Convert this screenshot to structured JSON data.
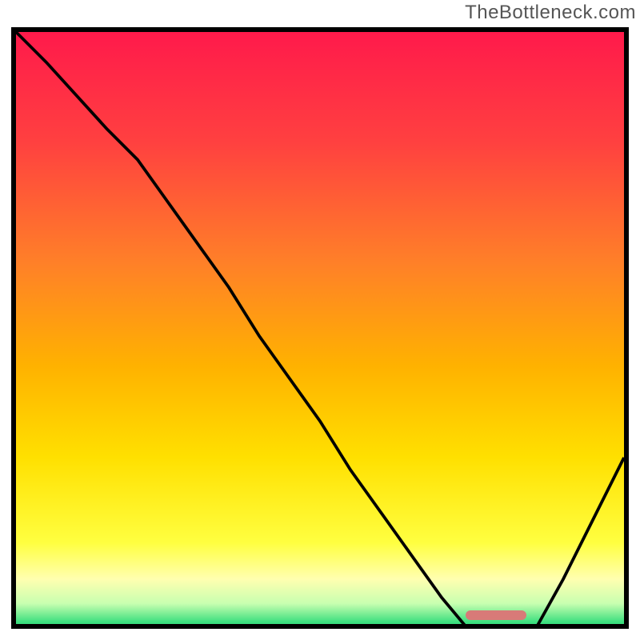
{
  "watermark": "TheBottleneck.com",
  "chart_data": {
    "type": "line",
    "title": "",
    "xlabel": "",
    "ylabel": "",
    "xlim": [
      0,
      100
    ],
    "ylim": [
      0,
      100
    ],
    "x": [
      0,
      5,
      15,
      20,
      25,
      30,
      35,
      40,
      45,
      50,
      55,
      60,
      65,
      70,
      75,
      80,
      85,
      90,
      95,
      100
    ],
    "values": [
      100,
      95,
      84,
      79,
      72,
      65,
      58,
      50,
      43,
      36,
      28,
      21,
      14,
      7,
      1,
      0,
      1,
      10,
      20,
      30
    ],
    "optimal_range_x": [
      74,
      84
    ],
    "gradient_stops": [
      {
        "pos": 0.0,
        "color": "#ff1a4b"
      },
      {
        "pos": 0.18,
        "color": "#ff4040"
      },
      {
        "pos": 0.38,
        "color": "#ff8028"
      },
      {
        "pos": 0.55,
        "color": "#ffb200"
      },
      {
        "pos": 0.7,
        "color": "#ffe000"
      },
      {
        "pos": 0.84,
        "color": "#ffff40"
      },
      {
        "pos": 0.9,
        "color": "#ffffb0"
      },
      {
        "pos": 0.94,
        "color": "#c8ffb0"
      },
      {
        "pos": 0.97,
        "color": "#40e080"
      },
      {
        "pos": 1.0,
        "color": "#00c070"
      }
    ]
  }
}
